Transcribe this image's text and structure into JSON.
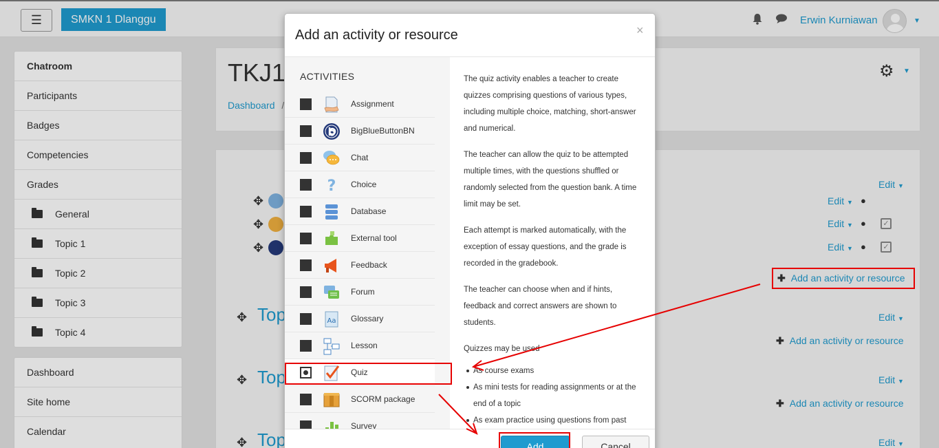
{
  "header": {
    "site_name": "SMKN 1 Dlanggu",
    "user_name": "Erwin Kurniawan",
    "menu_icon": "hamburger-icon",
    "bell_icon": "bell-icon",
    "message_icon": "speech-bubble-icon"
  },
  "sidebar": {
    "items": [
      "Chatroom",
      "Participants",
      "Badges",
      "Competencies",
      "Grades",
      "General",
      "Topic 1",
      "Topic 2",
      "Topic 3",
      "Topic 4"
    ],
    "nav_items": [
      "Dashboard",
      "Site home",
      "Calendar"
    ]
  },
  "course": {
    "title": "TKJ1",
    "breadcrumb_root": "Dashboard",
    "breadcrumb_sep": "/",
    "topic_heading_partial": "Top",
    "edit_label": "Edit",
    "add_activity_label": "Add an activity or resource"
  },
  "modal": {
    "title": "Add an activity or resource",
    "close_glyph": "×",
    "section_label": "ACTIVITIES",
    "activities": [
      {
        "label": "Assignment",
        "icon": "assignment-icon"
      },
      {
        "label": "BigBlueButtonBN",
        "icon": "bigbluebutton-icon"
      },
      {
        "label": "Chat",
        "icon": "chat-icon"
      },
      {
        "label": "Choice",
        "icon": "question-mark-icon"
      },
      {
        "label": "Database",
        "icon": "database-icon"
      },
      {
        "label": "External tool",
        "icon": "puzzle-icon"
      },
      {
        "label": "Feedback",
        "icon": "megaphone-icon"
      },
      {
        "label": "Forum",
        "icon": "forum-icon"
      },
      {
        "label": "Glossary",
        "icon": "glossary-icon"
      },
      {
        "label": "Lesson",
        "icon": "lesson-icon"
      },
      {
        "label": "Quiz",
        "icon": "quiz-icon",
        "selected": true
      },
      {
        "label": "SCORM package",
        "icon": "scorm-package-icon"
      },
      {
        "label": "Survey",
        "icon": "survey-icon"
      }
    ],
    "description": {
      "p1": "The quiz activity enables a teacher to create quizzes comprising questions of various types, including multiple choice, matching, short-answer and numerical.",
      "p2": "The teacher can allow the quiz to be attempted multiple times, with the questions shuffled or randomly selected from the question bank. A time limit may be set.",
      "p3": "Each attempt is marked automatically, with the exception of essay questions, and the grade is recorded in the gradebook.",
      "p4": "The teacher can choose when and if hints, feedback and correct answers are shown to students.",
      "p5": "Quizzes may be used",
      "bullets": [
        "As course exams",
        "As mini tests for reading assignments or at the end of a topic",
        "As exam practice using questions from past"
      ]
    },
    "add_label": "Add",
    "cancel_label": "Cancel"
  },
  "colors": {
    "accent": "#1f9bcf",
    "annotation": "#e60000",
    "quiz_check": "#e8541c"
  }
}
